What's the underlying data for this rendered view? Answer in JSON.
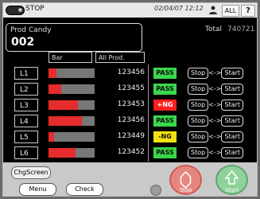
{
  "status_bar": {
    "status_text": "STOP",
    "datetime": "02/04/07 12:12",
    "all_label": "ALL",
    "help_label": "?"
  },
  "product": {
    "prod_label": "Prod",
    "name": "Candy",
    "number": "002"
  },
  "total": {
    "label": "Total",
    "value": "740721 pc"
  },
  "table": {
    "header_bar": "Bar",
    "header_all": "All Prod.",
    "rows": [
      {
        "line": "L1",
        "fill": 0.18,
        "count": "123456",
        "status": "PASS",
        "status_color": "#39d84a",
        "stop": "Stop",
        "arrow": "<->",
        "start": "Start"
      },
      {
        "line": "L2",
        "fill": 0.28,
        "count": "123455",
        "status": "PASS",
        "status_color": "#39d84a",
        "stop": "Stop",
        "arrow": "<->",
        "start": "Start"
      },
      {
        "line": "L3",
        "fill": 0.64,
        "count": "123453",
        "status": "+NG",
        "status_color": "#ff2020",
        "stop": "Stop",
        "arrow": "<->",
        "start": "Start"
      },
      {
        "line": "L4",
        "fill": 0.72,
        "count": "123456",
        "status": "PASS",
        "status_color": "#39d84a",
        "stop": "Stop",
        "arrow": "<->",
        "start": "Start"
      },
      {
        "line": "L5",
        "fill": 0.12,
        "count": "123449",
        "status": "-NG",
        "status_color": "#f5e10f",
        "stop": "Stop",
        "arrow": "<->",
        "start": "Start"
      },
      {
        "line": "L6",
        "fill": 0.58,
        "count": "123452",
        "status": "PASS",
        "status_color": "#39d84a",
        "stop": "Stop",
        "arrow": "<->",
        "start": "Start"
      }
    ]
  },
  "bottom": {
    "chg_screen": "ChgScreen",
    "menu": "Menu",
    "check": "Check",
    "stop": "Stop",
    "start": "Start"
  }
}
